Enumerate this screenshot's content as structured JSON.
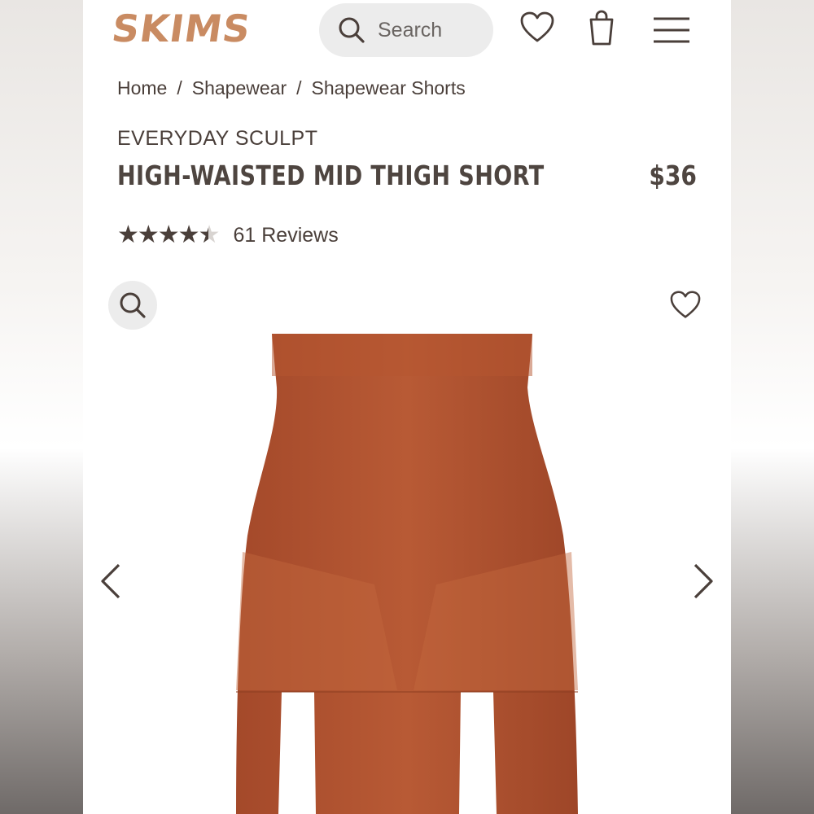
{
  "header": {
    "logo": "SKIMS",
    "search_placeholder": "Search",
    "icons": [
      "search-icon",
      "heart-icon",
      "shopping-bag-icon",
      "menu-icon"
    ]
  },
  "breadcrumb": [
    "Home",
    "Shapewear",
    "Shapewear Shorts"
  ],
  "product": {
    "collection": "EVERYDAY SCULPT",
    "title": "HIGH-WAISTED MID THIGH SHORT",
    "price": "$36",
    "rating": 4.5,
    "rating_max": 5,
    "reviews": "61 Reviews",
    "color": "#b5552f"
  },
  "gallery": {
    "icons": [
      "zoom-icon",
      "favorite-heart-icon",
      "chevron-left-icon",
      "chevron-right-icon"
    ]
  },
  "colors": {
    "text": "#4a3f3a",
    "logo": "#c98b62",
    "pill": "#ececec"
  }
}
